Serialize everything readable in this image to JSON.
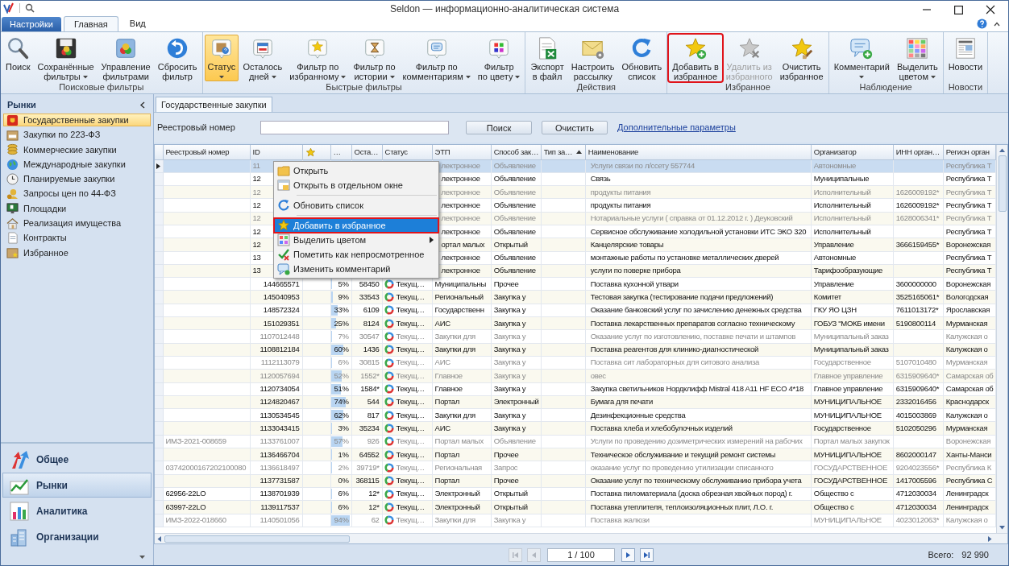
{
  "window": {
    "title": "Seldon — информационно-аналитическая система"
  },
  "ribbon_tabs": [
    {
      "label": "Настройки",
      "kind": "app"
    },
    {
      "label": "Главная",
      "kind": "tab",
      "selected": true
    },
    {
      "label": "Вид",
      "kind": "tab",
      "selected": false
    }
  ],
  "ribbon_groups": [
    {
      "title": "Поисковые фильтры",
      "buttons": [
        {
          "lines": [
            "Поиск"
          ],
          "dropdown": false,
          "selected": false,
          "disabled": false,
          "highlighted": false
        },
        {
          "lines": [
            "Сохранённые",
            "фильтры"
          ],
          "dropdown": true,
          "selected": false,
          "disabled": false,
          "highlighted": false
        },
        {
          "lines": [
            "Управление",
            "фильтрами"
          ],
          "dropdown": false,
          "selected": false,
          "disabled": false,
          "highlighted": false
        },
        {
          "lines": [
            "Сбросить",
            "фильтр"
          ],
          "dropdown": false,
          "selected": false,
          "disabled": false,
          "highlighted": false
        }
      ]
    },
    {
      "title": "Быстрые фильтры",
      "buttons": [
        {
          "lines": [
            "Статус"
          ],
          "dropdown": true,
          "selected": true,
          "disabled": false,
          "highlighted": false
        },
        {
          "lines": [
            "Осталось",
            "дней"
          ],
          "dropdown": true,
          "selected": false,
          "disabled": false,
          "highlighted": false
        },
        {
          "lines": [
            "Фильтр по",
            "избранному"
          ],
          "dropdown": true,
          "selected": false,
          "disabled": false,
          "highlighted": false
        },
        {
          "lines": [
            "Фильтр по",
            "истории"
          ],
          "dropdown": true,
          "selected": false,
          "disabled": false,
          "highlighted": false
        },
        {
          "lines": [
            "Фильтр по",
            "комментариям"
          ],
          "dropdown": true,
          "selected": false,
          "disabled": false,
          "highlighted": false
        },
        {
          "lines": [
            "Фильтр",
            "по цвету"
          ],
          "dropdown": true,
          "selected": false,
          "disabled": false,
          "highlighted": false
        }
      ]
    },
    {
      "title": "Действия",
      "buttons": [
        {
          "lines": [
            "Экспорт",
            "в файл"
          ],
          "dropdown": false,
          "selected": false,
          "disabled": false,
          "highlighted": false
        },
        {
          "lines": [
            "Настроить",
            "рассылку"
          ],
          "dropdown": false,
          "selected": false,
          "disabled": false,
          "highlighted": false
        },
        {
          "lines": [
            "Обновить",
            "список"
          ],
          "dropdown": false,
          "selected": false,
          "disabled": false,
          "highlighted": false
        }
      ]
    },
    {
      "title": "Избранное",
      "buttons": [
        {
          "lines": [
            "Добавить в",
            "избранное"
          ],
          "dropdown": false,
          "selected": false,
          "disabled": false,
          "highlighted": true
        },
        {
          "lines": [
            "Удалить из",
            "избранного"
          ],
          "dropdown": false,
          "selected": false,
          "disabled": true,
          "highlighted": false
        },
        {
          "lines": [
            "Очистить",
            "избранное"
          ],
          "dropdown": false,
          "selected": false,
          "disabled": false,
          "highlighted": false
        }
      ]
    },
    {
      "title": "Наблюдение",
      "buttons": [
        {
          "lines": [
            "Комментарий"
          ],
          "dropdown": true,
          "selected": false,
          "disabled": false,
          "highlighted": false
        },
        {
          "lines": [
            "Выделить",
            "цветом"
          ],
          "dropdown": true,
          "selected": false,
          "disabled": false,
          "highlighted": false
        }
      ]
    },
    {
      "title": "Новости",
      "buttons": [
        {
          "lines": [
            "Новости"
          ],
          "dropdown": false,
          "selected": false,
          "disabled": false,
          "highlighted": false
        }
      ]
    }
  ],
  "sidebar": {
    "title": "Рынки",
    "items": [
      {
        "label": "Государственные закупки",
        "selected": true
      },
      {
        "label": "Закупки по 223-ФЗ",
        "selected": false
      },
      {
        "label": "Коммерческие закупки",
        "selected": false
      },
      {
        "label": "Международные закупки",
        "selected": false
      },
      {
        "label": "Планируемые закупки",
        "selected": false
      },
      {
        "label": "Запросы цен по 44-ФЗ",
        "selected": false
      },
      {
        "label": "Площадки",
        "selected": false
      },
      {
        "label": "Реализация имущества",
        "selected": false
      },
      {
        "label": "Контракты",
        "selected": false
      },
      {
        "label": "Избранное",
        "selected": false
      }
    ],
    "nav": [
      {
        "label": "Общее",
        "selected": false
      },
      {
        "label": "Рынки",
        "selected": true
      },
      {
        "label": "Аналитика",
        "selected": false
      },
      {
        "label": "Организации",
        "selected": false
      }
    ]
  },
  "document_tab": {
    "label": "Государственные закупки"
  },
  "filter": {
    "label": "Реестровый номер",
    "buttons": [
      "Поиск",
      "Очистить"
    ],
    "link": "Дополнительные параметры"
  },
  "table": {
    "columns": [
      {
        "kind": "text",
        "label": "Реестровый номер",
        "sorted": false
      },
      {
        "kind": "text",
        "label": "ID",
        "sorted": false
      },
      {
        "kind": "icon",
        "sorted": false
      },
      {
        "kind": "text",
        "label": "…",
        "sorted": false
      },
      {
        "kind": "text",
        "label": "Оста…",
        "sorted": false
      },
      {
        "kind": "text",
        "label": "Статус",
        "sorted": false
      },
      {
        "kind": "text",
        "label": "ЭТП",
        "sorted": false
      },
      {
        "kind": "text",
        "label": "Способ зак…",
        "sorted": false
      },
      {
        "kind": "text",
        "label": "Тип за…",
        "sorted": true
      },
      {
        "kind": "text",
        "label": "Наименование",
        "sorted": false
      },
      {
        "kind": "text",
        "label": "Организатор",
        "sorted": false
      },
      {
        "kind": "text",
        "label": "ИНН орган…",
        "sorted": false
      },
      {
        "kind": "text",
        "label": "Регион орган",
        "sorted": false
      }
    ],
    "rows": [
      {
        "kind": "covered",
        "selected": true,
        "viewed": true,
        "id": "11",
        "etp": "лектронное",
        "method": "Объявление",
        "name": "Услуги связи по л/ссету 557744",
        "org": "Автономные",
        "region": "Республика Т"
      },
      {
        "kind": "covered",
        "selected": false,
        "viewed": false,
        "id": "12",
        "etp": "лектронное",
        "method": "Объявление",
        "name": "Связь",
        "org": "Муниципальные",
        "region": "Республика Т"
      },
      {
        "kind": "covered",
        "selected": false,
        "viewed": true,
        "id": "12",
        "etp": "лектронное",
        "method": "Объявление",
        "name": "продукты питания",
        "org": "Исполнительный",
        "inn": "1626009192*",
        "region": "Республика Т"
      },
      {
        "kind": "covered",
        "selected": false,
        "viewed": false,
        "id": "12",
        "etp": "лектронное",
        "method": "Объявление",
        "name": "продукты питания",
        "org": "Исполнительный",
        "inn": "1626009192*",
        "region": "Республика Т"
      },
      {
        "kind": "covered",
        "selected": false,
        "viewed": true,
        "id": "12",
        "etp": "лектронное",
        "method": "Объявление",
        "name": "Нотариальные услуги ( справка от 01.12.2012 г. ) Деуковский",
        "org": "Исполнительный",
        "inn": "1628006341*",
        "region": "Республика Т"
      },
      {
        "kind": "covered",
        "selected": false,
        "viewed": false,
        "id": "12",
        "etp": "лектронное",
        "method": "Объявление",
        "name": "Сервисное обслуживание холодильной установки ИТС ЭКО 320",
        "org": "Исполнительный",
        "region": "Республика Т"
      },
      {
        "kind": "covered",
        "selected": false,
        "viewed": false,
        "id": "12",
        "etp": "ортал малых",
        "method": "Открытый",
        "name": "Канцелярские товары",
        "org": "Управление",
        "inn": "3666159455*",
        "region": "Воронежская"
      },
      {
        "kind": "covered",
        "selected": false,
        "viewed": false,
        "id": "13",
        "etp": "лектронное",
        "method": "Объявление",
        "name": "монтажные работы по установке металлических дверей",
        "org": "Автономные",
        "region": "Республика Т"
      },
      {
        "kind": "covered",
        "selected": false,
        "viewed": false,
        "id": "13",
        "etp": "лектронное",
        "method": "Объявление",
        "name": "услуги по поверке прибора",
        "org": "Тарифообразующие",
        "region": "Республика Т"
      },
      {
        "kind": "full",
        "selected": false,
        "viewed": false,
        "id": "144665571",
        "pct": "5%",
        "level": 0.05,
        "rest": "58450",
        "status": "Текущ…",
        "etp": "Муниципальны",
        "method": "Прочее",
        "name": "Поставка кухонной утвари",
        "org": "Управление",
        "inn": "3600000000",
        "region": "Воронежская"
      },
      {
        "kind": "full",
        "selected": false,
        "viewed": false,
        "id": "145040953",
        "pct": "9%",
        "level": 0.09,
        "rest": "33543",
        "status": "Текущ…",
        "etp": "Региональный",
        "method": "Закупка у",
        "name": "Тестовая закупка (тестирование подачи предложений)",
        "org": "Комитет",
        "inn": "3525165061*",
        "region": "Вологодская"
      },
      {
        "kind": "full",
        "selected": false,
        "viewed": false,
        "id": "148572324",
        "pct": "33%",
        "level": 0.33,
        "rest": "6109",
        "status": "Текущ…",
        "etp": "Государственн",
        "method": "Закупка у",
        "name": "Оказание банковский услуг по зачислению денежных средства",
        "org": "ГКУ ЯО ЦЗН",
        "inn": "7611013172*",
        "region": "Ярославская"
      },
      {
        "kind": "full",
        "selected": false,
        "viewed": false,
        "id": "151029351",
        "pct": "25%",
        "level": 0.25,
        "rest": "8124",
        "status": "Текущ…",
        "etp": "АИС",
        "method": "Закупка у",
        "name": "Поставка лекарственных препаратов согласно техническому",
        "org": "ГОБУЗ \"МОКБ имени",
        "inn": "5190800114",
        "region": "Мурманская"
      },
      {
        "kind": "full",
        "selected": false,
        "viewed": true,
        "id": "1107012448",
        "pct": "7%",
        "level": 0.07,
        "rest": "30547",
        "status": "Текущ…",
        "etp": "Закупки для",
        "method": "Закупка у",
        "name": "Оказание услуг по изготовлению, поставке печати и штампов",
        "org": "Муниципальный заказ",
        "region": "Калужская о"
      },
      {
        "kind": "full",
        "selected": false,
        "viewed": false,
        "id": "1108812184",
        "pct": "60%",
        "level": 0.6,
        "rest": "1436",
        "status": "Текущ…",
        "etp": "Закупки для",
        "method": "Закупка у",
        "name": "Поставка реагентов для клинико-диагностической",
        "org": "Муниципальный заказ",
        "region": "Калужская о"
      },
      {
        "kind": "full",
        "selected": false,
        "viewed": true,
        "id": "1112113079",
        "pct": "6%",
        "level": 0.06,
        "rest": "30815",
        "status": "Текущ…",
        "etp": "АИС",
        "method": "Закупка у",
        "name": "Поставка сит лабораторных для ситового анализа",
        "org": "Государственное",
        "inn": "5107010480",
        "region": "Мурманская"
      },
      {
        "kind": "full",
        "selected": false,
        "viewed": true,
        "id": "1120057694",
        "pct": "52%",
        "level": 0.52,
        "rest": "1552*",
        "status": "Текущ…",
        "etp": "Главное",
        "method": "Закупка у",
        "name": "овес",
        "org": "Главное управление",
        "inn": "6315909640*",
        "region": "Самарская об"
      },
      {
        "kind": "full",
        "selected": false,
        "viewed": false,
        "id": "1120734054",
        "pct": "51%",
        "level": 0.51,
        "rest": "1584*",
        "status": "Текущ…",
        "etp": "Главное",
        "method": "Закупка у",
        "name": "Закупка светильников Нордклифф Mistral 418 A11 HF ECO 4*18",
        "org": "Главное управление",
        "inn": "6315909640*",
        "region": "Самарская об"
      },
      {
        "kind": "full",
        "selected": false,
        "viewed": false,
        "id": "1124820467",
        "pct": "74%",
        "level": 0.74,
        "rest": "544",
        "status": "Текущ…",
        "etp": "Портал",
        "method": "Электронный",
        "name": "Бумага для печати",
        "org": "МУНИЦИПАЛЬНОЕ",
        "inn": "2332016456",
        "region": "Краснодарск"
      },
      {
        "kind": "full",
        "selected": false,
        "viewed": false,
        "id": "1130534545",
        "pct": "62%",
        "level": 0.62,
        "rest": "817",
        "status": "Текущ…",
        "etp": "Закупки для",
        "method": "Закупка у",
        "name": "Дезинфекционные средства",
        "org": "МУНИЦИПАЛЬНОЕ",
        "inn": "4015003869",
        "region": "Калужская о"
      },
      {
        "kind": "full",
        "selected": false,
        "viewed": false,
        "id": "1133043415",
        "pct": "3%",
        "level": 0.03,
        "rest": "35234",
        "status": "Текущ…",
        "etp": "АИС",
        "method": "Закупка у",
        "name": "Поставка хлеба и хлебобулочных изделий",
        "org": "Государственное",
        "inn": "5102050296",
        "region": "Мурманская"
      },
      {
        "kind": "full",
        "selected": false,
        "viewed": true,
        "reg": "ИМЗ-2021-008659",
        "id": "1133761007",
        "pct": "57%",
        "level": 0.57,
        "rest": "926",
        "status": "Текущ…",
        "etp": "Портал малых",
        "method": "Объявление",
        "name": "Услуги по проведению дозиметрических измерений на рабочих",
        "org": "Портал малых закупок",
        "region": "Воронежская"
      },
      {
        "kind": "full",
        "selected": false,
        "viewed": false,
        "id": "1136466704",
        "pct": "1%",
        "level": 0.01,
        "rest": "64552",
        "status": "Текущ…",
        "etp": "Портал",
        "method": "Прочее",
        "name": "Техническое обслуживание и текущий ремонт системы",
        "org": "МУНИЦИПАЛЬНОЕ",
        "inn": "8602000147",
        "region": "Ханты-Манси"
      },
      {
        "kind": "full",
        "selected": false,
        "viewed": true,
        "reg": "03742000167202100080",
        "id": "1136618497",
        "pct": "2%",
        "level": 0.02,
        "rest": "39719*",
        "status": "Текущ…",
        "etp": "Региональная",
        "method": "Запрос",
        "name": "оказание услуг по проведению утилизации списанного",
        "org": "ГОСУДАРСТВЕННОЕ",
        "inn": "9204023556*",
        "region": "Республика К"
      },
      {
        "kind": "full",
        "selected": false,
        "viewed": false,
        "id": "1137731587",
        "pct": "0%",
        "level": 0,
        "rest": "368115",
        "status": "Текущ…",
        "etp": "Портал",
        "method": "Прочее",
        "name": "Оказание услуг по техническому обслуживанию прибора учета",
        "org": "ГОСУДАРСТВЕННОЕ",
        "inn": "1417005596",
        "region": "Республика С"
      },
      {
        "kind": "full",
        "selected": false,
        "viewed": false,
        "reg": "62956-22LO",
        "id": "1138701939",
        "pct": "6%",
        "level": 0.06,
        "rest": "12*",
        "status": "Текущ…",
        "etp": "Электронный",
        "method": "Открытый",
        "name": "Поставка пиломатериала (доска обрезная хвойных пород) г.",
        "org": "Общество с",
        "inn": "4712030034",
        "region": "Ленинградск"
      },
      {
        "kind": "full",
        "selected": false,
        "viewed": false,
        "reg": "63997-22LO",
        "id": "1139117537",
        "pct": "6%",
        "level": 0.06,
        "rest": "12*",
        "status": "Текущ…",
        "etp": "Электронный",
        "method": "Открытый",
        "name": "Поставка утеплителя, теплоизоляционных плит, Л.О. г.",
        "org": "Общество с",
        "inn": "4712030034",
        "region": "Ленинградск"
      },
      {
        "kind": "full",
        "selected": false,
        "viewed": true,
        "reg": "ИМЗ-2022-018660",
        "id": "1140501056",
        "pct": "94%",
        "level": 0.94,
        "rest": "62",
        "status": "Текущ…",
        "etp": "Закупки для",
        "method": "Закупка у",
        "name": "Поставка жалюзи",
        "org": "МУНИЦИПАЛЬНОЕ",
        "inn": "4023012063*",
        "region": "Калужская о"
      }
    ]
  },
  "context_menu": {
    "items": [
      {
        "kind": "item",
        "label": "Открыть",
        "highlighted": false,
        "submenu": false
      },
      {
        "kind": "item",
        "label": "Открыть в отдельном окне",
        "highlighted": false,
        "submenu": false
      },
      {
        "kind": "separator"
      },
      {
        "kind": "item",
        "label": "Обновить список",
        "highlighted": false,
        "submenu": false
      },
      {
        "kind": "separator"
      },
      {
        "kind": "item",
        "label": "Добавить в избранное",
        "highlighted": true,
        "submenu": false
      },
      {
        "kind": "item",
        "label": "Выделить цветом",
        "highlighted": false,
        "submenu": true
      },
      {
        "kind": "item",
        "label": "Пометить как непросмотренное",
        "highlighted": false,
        "submenu": false
      },
      {
        "kind": "item",
        "label": "Изменить комментарий",
        "highlighted": false,
        "submenu": false
      }
    ]
  },
  "pager": {
    "page": "1 / 100",
    "first_disabled": true,
    "prev_disabled": true,
    "next_disabled": false,
    "last_disabled": false
  },
  "status": {
    "total_label": "Всего:",
    "total": "92 990"
  }
}
